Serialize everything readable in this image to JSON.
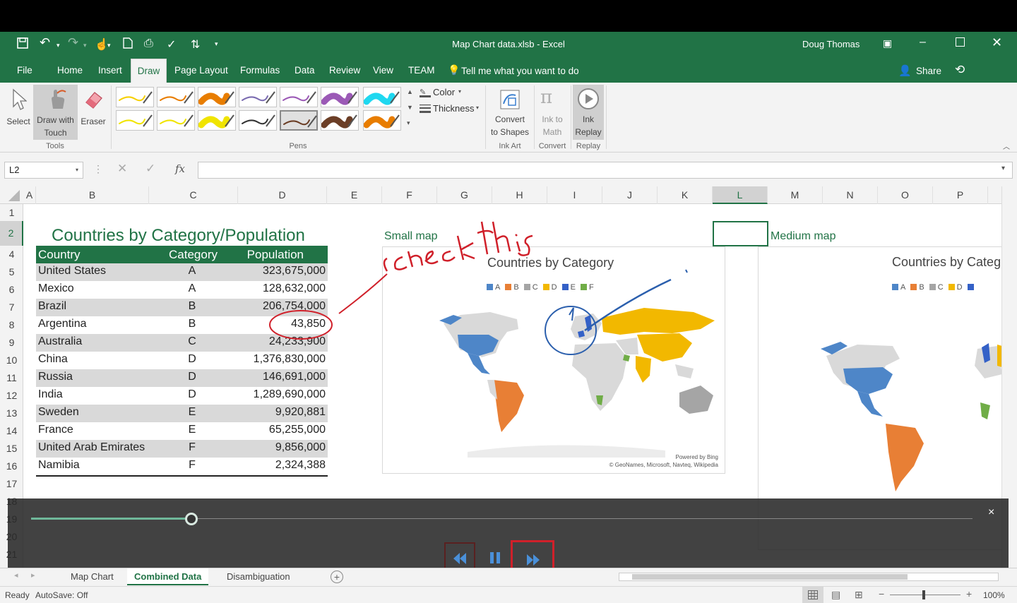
{
  "window": {
    "title": "Map Chart data.xlsb  -  Excel",
    "user": "Doug Thomas",
    "share_label": "Share"
  },
  "tabs": [
    "File",
    "Home",
    "Insert",
    "Draw",
    "Page Layout",
    "Formulas",
    "Data",
    "Review",
    "View",
    "TEAM"
  ],
  "active_tab": "Draw",
  "tell_me": "Tell me what you want to do",
  "ribbon": {
    "select": "Select",
    "draw_touch_1": "Draw with",
    "draw_touch_2": "Touch",
    "eraser": "Eraser",
    "tools_group": "Tools",
    "pens_group": "Pens",
    "color": "Color",
    "thickness": "Thickness",
    "convert_1": "Convert",
    "convert_2": "to Shapes",
    "inkart_group": "Ink Art",
    "inkmath_1": "Ink to",
    "inkmath_2": "Math",
    "convert_group": "Convert",
    "replay_1": "Ink",
    "replay_2": "Replay",
    "replay_group": "Replay",
    "pen_colors": [
      "#f7d000",
      "#e87d00",
      "#e87d00",
      "#7a6bb0",
      "#9b59b6",
      "#9b59b6",
      "#1fd8f0",
      "#f0e400",
      "#f0e400",
      "#f0e400",
      "#333333",
      "#6b3e26",
      "#6b3e26",
      "#e87d00"
    ]
  },
  "formula": {
    "name_box": "L2",
    "fx": "fx"
  },
  "columns": [
    "A",
    "B",
    "C",
    "D",
    "E",
    "F",
    "G",
    "H",
    "I",
    "J",
    "K",
    "L",
    "M",
    "N",
    "O",
    "P"
  ],
  "selected_column": "L",
  "rows": [
    "1",
    "2",
    "4",
    "5",
    "6",
    "7",
    "8",
    "9",
    "10",
    "11",
    "12",
    "13",
    "14",
    "15",
    "16",
    "17",
    "18",
    "19",
    "20",
    "21"
  ],
  "selected_row": "2",
  "table": {
    "title": "Countries by Category/Population",
    "headers": [
      "Country",
      "Category",
      "Population"
    ],
    "rows": [
      [
        "United States",
        "A",
        "323,675,000"
      ],
      [
        "Mexico",
        "A",
        "128,632,000"
      ],
      [
        "Brazil",
        "B",
        "206,754,000"
      ],
      [
        "Argentina",
        "B",
        "43,850"
      ],
      [
        "Australia",
        "C",
        "24,233,900"
      ],
      [
        "China",
        "D",
        "1,376,830,000"
      ],
      [
        "Russia",
        "D",
        "146,691,000"
      ],
      [
        "India",
        "D",
        "1,289,690,000"
      ],
      [
        "Sweden",
        "E",
        "9,920,881"
      ],
      [
        "France",
        "E",
        "65,255,000"
      ],
      [
        "United Arab Emirates",
        "F",
        "9,856,000"
      ],
      [
        "Namibia",
        "F",
        "2,324,388"
      ]
    ]
  },
  "small_map": {
    "label": "Small map",
    "chart_title": "Countries by Category",
    "legend": [
      {
        "name": "A",
        "color": "#4e86c8"
      },
      {
        "name": "B",
        "color": "#e87f35"
      },
      {
        "name": "C",
        "color": "#a5a5a5"
      },
      {
        "name": "D",
        "color": "#f2b800"
      },
      {
        "name": "E",
        "color": "#3461c7"
      },
      {
        "name": "F",
        "color": "#70ad47"
      }
    ],
    "credit_1": "Powered by Bing",
    "credit_2": "© GeoNames, Microsoft, Navteq, Wikipedia"
  },
  "medium_map": {
    "label": "Medium map",
    "chart_title": "Countries by Categ",
    "legend": [
      "A",
      "B",
      "C",
      "D"
    ]
  },
  "ink": {
    "annotation_text": "check this",
    "stroke_color": "#d0202a",
    "blue_color": "#2b5fad"
  },
  "playback": {
    "close": "×",
    "progress": 0.17
  },
  "sheets": [
    "Map Chart",
    "Combined Data",
    "Disambiguation"
  ],
  "active_sheet": "Combined Data",
  "status": {
    "ready": "Ready",
    "autosave": "AutoSave: Off",
    "zoom": "100%"
  }
}
